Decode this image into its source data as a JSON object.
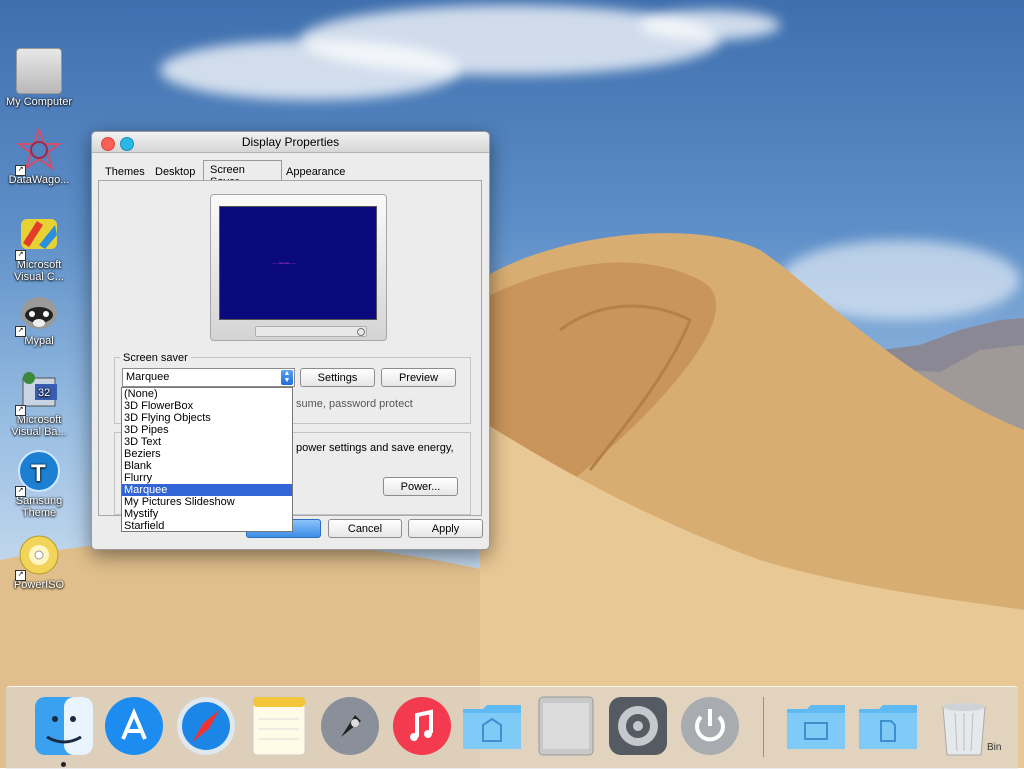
{
  "desktop": {
    "icons": [
      {
        "label": "My Computer"
      },
      {
        "label": "DataWago..."
      },
      {
        "label": "Microsoft Visual C..."
      },
      {
        "label": "Mypal"
      },
      {
        "label": "Microsoft Visual Ba..."
      },
      {
        "label": "Samsung Theme"
      },
      {
        "label": "PowerISO"
      }
    ]
  },
  "window": {
    "title": "Display Properties",
    "tabs": [
      {
        "label": "Themes"
      },
      {
        "label": "Desktop"
      },
      {
        "label": "Screen Saver",
        "active": true
      },
      {
        "label": "Appearance"
      }
    ],
    "preview_text": "~~~ marquee ~~~",
    "screen_saver_group": {
      "label": "Screen saver",
      "selected": "Marquee",
      "settings_label": "Settings",
      "preview_label": "Preview",
      "resume_text": "sume, password protect"
    },
    "power_group": {
      "text": "power settings and save energy,",
      "power_label": "Power..."
    },
    "dropdown_options": [
      "(None)",
      "3D FlowerBox",
      "3D Flying Objects",
      "3D Pipes",
      "3D Text",
      "Beziers",
      "Blank",
      "Flurry",
      "Marquee",
      "My Pictures Slideshow",
      "Mystify",
      "Starfield"
    ],
    "buttons": {
      "ok": "",
      "cancel": "Cancel",
      "apply": "Apply"
    }
  },
  "dock": {
    "items": [
      "finder-icon",
      "app-store-icon",
      "safari-icon",
      "notes-icon",
      "launchpad-icon",
      "music-icon",
      "applications-folder-icon",
      "mac-pro-icon",
      "system-preferences-icon",
      "shutdown-icon",
      "documents-folder-icon",
      "downloads-folder-icon",
      "trash-icon"
    ],
    "trash_label": "Bin"
  },
  "colors": {
    "selection": "#3265d6",
    "screensaver_bg": "#0b0a7c",
    "traffic_close": "#fc5f57",
    "traffic_min": "#2ab7e8"
  }
}
